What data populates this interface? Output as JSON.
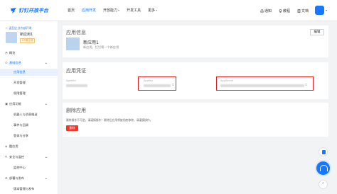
{
  "brand": {
    "name": "钉钉开放平台",
    "color": "#1677ff"
  },
  "nav": [
    {
      "label": "首页",
      "has_menu": false,
      "active": false
    },
    {
      "label": "应用开发",
      "has_menu": false,
      "active": true
    },
    {
      "label": "开放能力",
      "has_menu": true,
      "active": false
    },
    {
      "label": "开发工具",
      "has_menu": false,
      "active": false
    },
    {
      "label": "更多",
      "has_menu": true,
      "active": false
    }
  ],
  "top_right": {
    "notify": {
      "label": "通知",
      "icon": "bell-icon"
    },
    "tutorial": {
      "label": "教程",
      "icon": "lightbulb-icon"
    },
    "docs": {
      "label": "文档",
      "icon": "document-icon"
    }
  },
  "sidebar": {
    "back_label": "← 返回企业内部开发",
    "app_name": "新应用1",
    "app_tag": "H5微应用",
    "items": [
      {
        "label": "概览",
        "icon": "clock-icon",
        "level": 1,
        "active": false,
        "expand": false
      },
      {
        "label": "基础信息",
        "icon": "info-icon",
        "level": 1,
        "active": false,
        "expand": true,
        "blue": true
      },
      {
        "label": "应用信息",
        "level": 2,
        "active": true
      },
      {
        "label": "开发管理",
        "level": 2,
        "active": false
      },
      {
        "label": "权限管理",
        "level": 2,
        "active": false
      },
      {
        "label": "应用功能",
        "icon": "app-icon",
        "level": 1,
        "active": false,
        "expand": true
      },
      {
        "label": "机器人与消息推送",
        "level": 2,
        "active": false
      },
      {
        "label": "事件与回调",
        "level": 2,
        "active": false
      },
      {
        "label": "登录与分享",
        "level": 2,
        "active": false
      },
      {
        "label": "酷应用",
        "icon": "cube-icon",
        "level": 1,
        "active": false,
        "expand": false
      },
      {
        "label": "安全与监控",
        "icon": "shield-icon",
        "level": 1,
        "active": false,
        "expand": true
      },
      {
        "label": "监控中心",
        "level": 2,
        "active": false
      },
      {
        "label": "部署与发布",
        "icon": "rocket-icon",
        "level": 1,
        "active": false,
        "expand": true
      },
      {
        "label": "版本管理与发布",
        "level": 2,
        "active": false
      }
    ]
  },
  "app_info": {
    "title": "应用信息",
    "edit_label": "编辑",
    "name": "新应用1",
    "description": "新应用，钉钉第一个新应用"
  },
  "credentials": {
    "title": "应用凭证",
    "fields": [
      {
        "label": "AgentId",
        "highlighted": false
      },
      {
        "label": "AppKey",
        "highlighted": true
      },
      {
        "label": "AppSecret",
        "highlighted": true
      }
    ]
  },
  "delete": {
    "title": "删除应用",
    "description": "删除操作不可逆，请谨慎操作！删除后应用将被彻底移除，请谨慎操作。",
    "button_label": "删除"
  },
  "colors": {
    "accent": "#1677ff",
    "danger": "#f5342c",
    "highlight": "#e02020"
  }
}
